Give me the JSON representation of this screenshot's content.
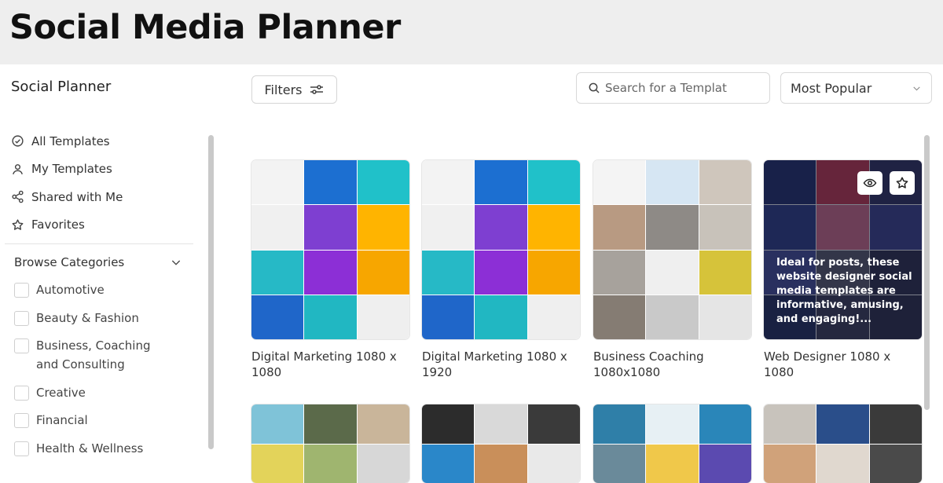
{
  "page": {
    "banner_title": "Social Media Planner"
  },
  "sidebar": {
    "title": "Social Planner",
    "nav": [
      {
        "label": "All Templates",
        "icon": "check-circle-icon"
      },
      {
        "label": "My Templates",
        "icon": "user-icon"
      },
      {
        "label": "Shared with Me",
        "icon": "share-icon"
      },
      {
        "label": "Favorites",
        "icon": "star-icon"
      }
    ],
    "categories_heading": "Browse Categories",
    "categories": [
      {
        "label": "Automotive",
        "checked": false
      },
      {
        "label": "Beauty & Fashion",
        "checked": false
      },
      {
        "label": "Business, Coaching and Consulting",
        "checked": false
      },
      {
        "label": "Creative",
        "checked": false
      },
      {
        "label": "Financial",
        "checked": false
      },
      {
        "label": "Health & Wellness",
        "checked": false
      }
    ]
  },
  "toolbar": {
    "filters_label": "Filters",
    "search_placeholder": "Search for a Templat",
    "sort_selected": "Most Popular"
  },
  "templates": [
    {
      "title": "Digital Marketing 1080 x 1080"
    },
    {
      "title": "Digital Marketing 1080 x 1920"
    },
    {
      "title": "Business Coaching 1080x1080"
    },
    {
      "title": "Web Designer 1080 x 1080",
      "hover_description": "Ideal for posts, these website designer social media templates are informative, amusing, and engaging!..."
    }
  ],
  "colors": {
    "accent": "#1a73e8",
    "text": "#333333",
    "border": "#d8d8d8",
    "banner_bg": "#eeeeee"
  }
}
